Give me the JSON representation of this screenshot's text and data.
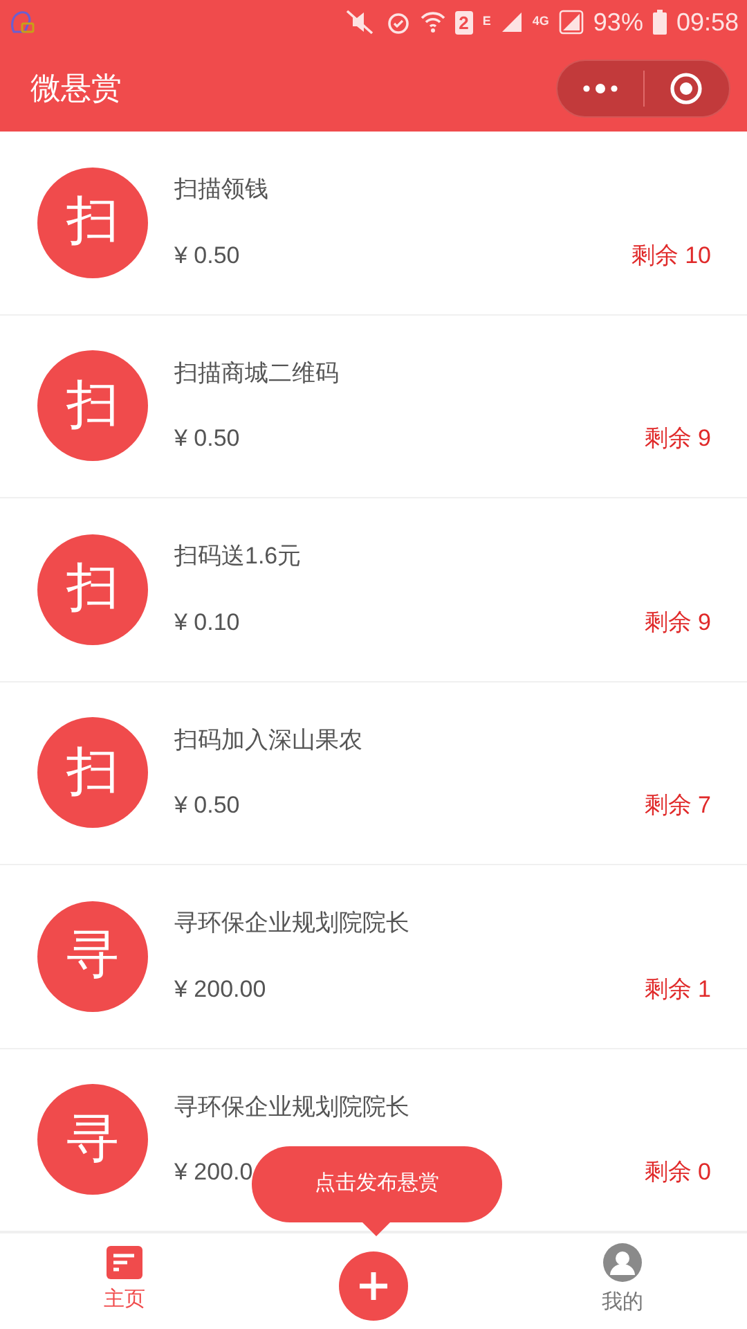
{
  "status_bar": {
    "sim": "2",
    "network_1": "E",
    "network_2": "4G",
    "battery": "93%",
    "time": "09:58"
  },
  "header": {
    "title": "微悬赏"
  },
  "tasks": [
    {
      "icon_char": "扫",
      "title": "扫描领钱",
      "price": "¥ 0.50",
      "remaining": "剩余 10"
    },
    {
      "icon_char": "扫",
      "title": "扫描商城二维码",
      "price": "¥ 0.50",
      "remaining": "剩余 9"
    },
    {
      "icon_char": "扫",
      "title": "扫码送1.6元",
      "price": "¥ 0.10",
      "remaining": "剩余 9"
    },
    {
      "icon_char": "扫",
      "title": "扫码加入深山果农",
      "price": "¥ 0.50",
      "remaining": "剩余 7"
    },
    {
      "icon_char": "寻",
      "title": "寻环保企业规划院院长",
      "price": "¥ 200.00",
      "remaining": "剩余 1"
    },
    {
      "icon_char": "寻",
      "title": "寻环保企业规划院院长",
      "price": "¥ 200.0",
      "remaining": "剩余 0"
    }
  ],
  "tooltip": "点击发布悬赏",
  "tab_bar": [
    {
      "kind": "home",
      "label": "主页",
      "selected": true
    },
    {
      "kind": "publish",
      "selected": false
    },
    {
      "kind": "profile",
      "label": "我的",
      "selected": false
    }
  ]
}
